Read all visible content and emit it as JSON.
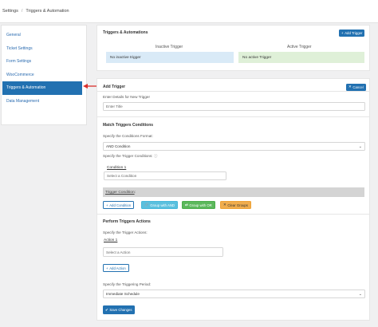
{
  "breadcrumb": {
    "root": "Settings",
    "separator": "/",
    "current": "Triggers & Automation"
  },
  "sidebar": {
    "items": [
      {
        "label": "General"
      },
      {
        "label": "Ticket Settings"
      },
      {
        "label": "Form Settings"
      },
      {
        "label": "WooCommerce"
      },
      {
        "label": "Triggers & Automation",
        "active": true
      },
      {
        "label": "Data Management"
      }
    ]
  },
  "triggers_panel": {
    "title": "Triggers & Automations",
    "add_button": "Add Trigger",
    "inactive_header": "Inactive Trigger",
    "active_header": "Active Trigger",
    "inactive_empty": "No inactive trigger",
    "active_empty": "No active Trigger"
  },
  "add_trigger": {
    "title": "Add Trigger",
    "cancel_button": "Cancel",
    "details_label": "Enter Details for New Trigger",
    "title_placeholder": "Enter Title",
    "conditions_title": "Match Triggers Conditions",
    "format_label": "Specify the Conditions Format:",
    "format_value": "AND Condition",
    "conditions_label": "Specify the Trigger Conditions:",
    "condition_label": "Condition 1",
    "condition_placeholder": "Select a Condition",
    "trigger_condition": "Trigger Condition",
    "trigger_condition_suffix": ":",
    "buttons": {
      "add_condition": "Add Condition",
      "group_and": "Group with AND",
      "group_or": "Group with OR",
      "clear_groups": "Clear Groups"
    },
    "actions_title": "Perform Triggers Actions",
    "actions_label": "Specify the Trigger Actions:",
    "action_label": "Action 1",
    "action_placeholder": "Select a Action",
    "add_action": "Add Action",
    "period_label": "Specify the Triggering Period:",
    "period_value": "Immediate Schedule",
    "save_button": "Save Changes"
  },
  "colors": {
    "primary": "#2271b1",
    "inactive_bg": "#d9eaf7",
    "active_bg": "#dff0d8",
    "arrow": "#d9302c"
  }
}
